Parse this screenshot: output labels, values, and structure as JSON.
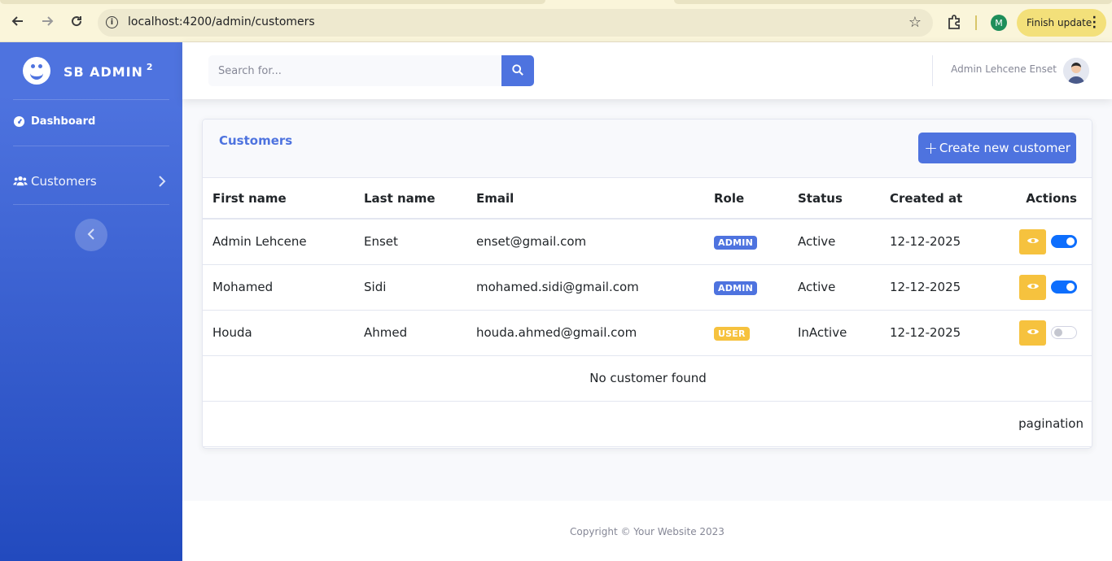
{
  "browser": {
    "url": "localhost:4200/admin/customers",
    "profile_initial": "M",
    "finish_update_label": "Finish update"
  },
  "sidebar": {
    "brand": "SB ADMIN",
    "brand_sup": "2",
    "items": [
      {
        "label": "Dashboard",
        "icon": "tachometer-icon"
      },
      {
        "label": "Customers",
        "icon": "users-icon"
      }
    ]
  },
  "topbar": {
    "search_placeholder": "Search for...",
    "user_name": "Admin Lehcene Enset"
  },
  "customers_card": {
    "title": "Customers",
    "create_button_label": "Create new customer",
    "columns": [
      "First name",
      "Last name",
      "Email",
      "Role",
      "Status",
      "Created at",
      "Actions"
    ],
    "rows": [
      {
        "first_name": "Admin Lehcene",
        "last_name": "Enset",
        "email": "enset@gmail.com",
        "role": "ADMIN",
        "status": "Active",
        "created_at": "12-12-2025",
        "enabled": true
      },
      {
        "first_name": "Mohamed",
        "last_name": "Sidi",
        "email": "mohamed.sidi@gmail.com",
        "role": "ADMIN",
        "status": "Active",
        "created_at": "12-12-2025",
        "enabled": true
      },
      {
        "first_name": "Houda",
        "last_name": "Ahmed",
        "email": "houda.ahmed@gmail.com",
        "role": "USER",
        "status": "InActive",
        "created_at": "12-12-2025",
        "enabled": false
      }
    ],
    "empty_message": "No customer found",
    "pagination_label": "pagination"
  },
  "footer": {
    "copyright": "Copyright © Your Website 2023"
  },
  "colors": {
    "primary": "#4e73df",
    "warning": "#f6c23e",
    "toggle_on": "#0d6efd"
  }
}
